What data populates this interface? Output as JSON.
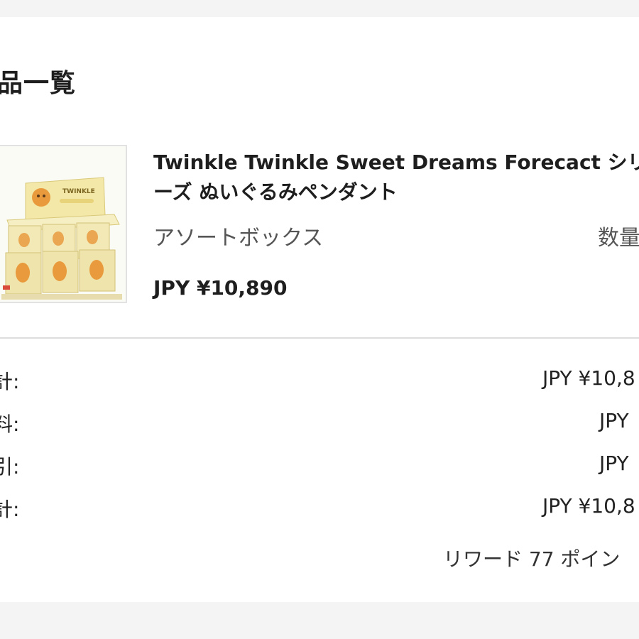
{
  "section": {
    "title": "品一覧"
  },
  "product": {
    "name": "Twinkle Twinkle Sweet Dreams Forecact シリーズ ぬいぐるみペンダント",
    "variant": "アソートボックス",
    "quantity_label": "数量",
    "price": "JPY ¥10,890",
    "image_text": "TWINKLE"
  },
  "summary": {
    "rows": [
      {
        "label": "計:",
        "value": "JPY ¥10,8"
      },
      {
        "label": "料:",
        "value": "JPY"
      },
      {
        "label": "引:",
        "value": "JPY"
      },
      {
        "label": "計:",
        "value": "JPY ¥10,8"
      }
    ],
    "reward": "リワード 77 ポイン"
  },
  "colors": {
    "background": "#f4f4f4",
    "card": "#ffffff",
    "divider": "#dddddd",
    "box_yellow": "#f2e7a6",
    "figure_orange": "#e89a3c"
  }
}
